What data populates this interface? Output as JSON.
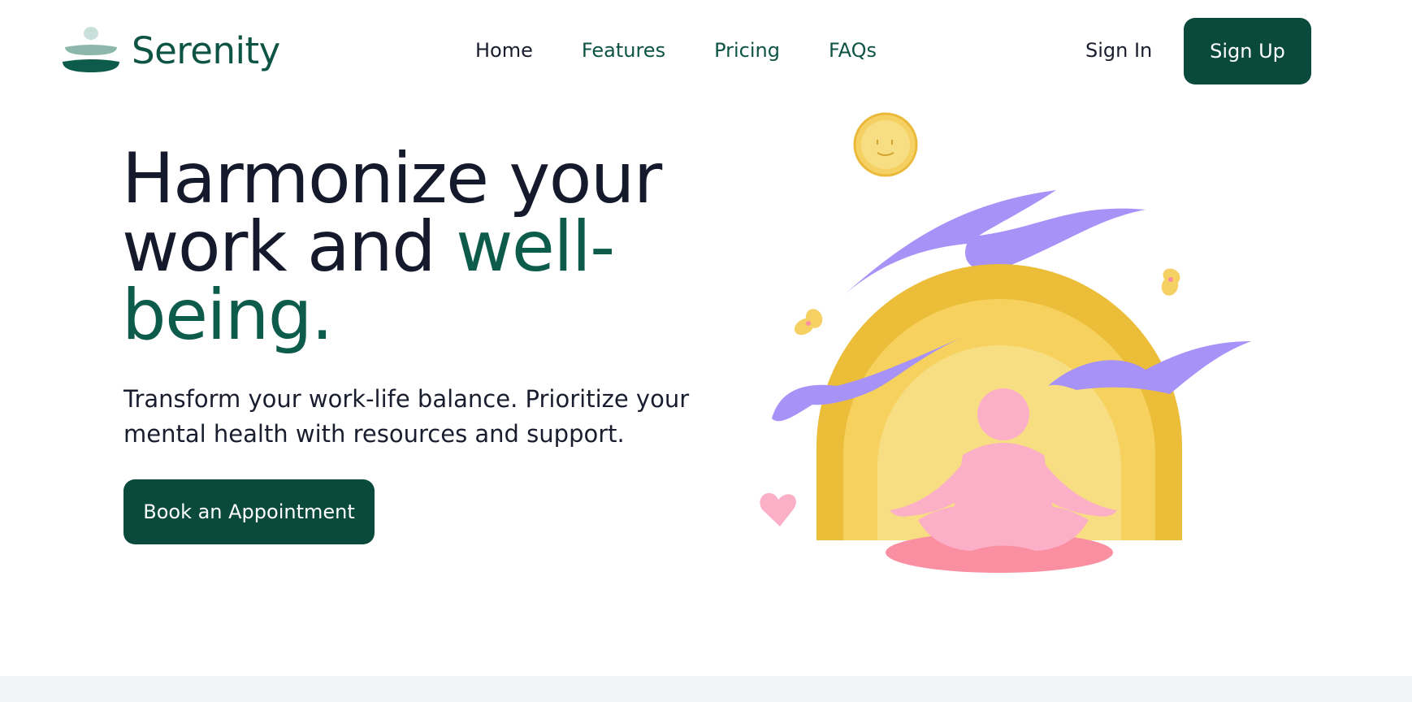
{
  "brand": {
    "name": "Serenity"
  },
  "nav": {
    "items": [
      "Home",
      "Features",
      "Pricing",
      "FAQs"
    ],
    "sign_in": "Sign In",
    "sign_up": "Sign Up"
  },
  "hero": {
    "title_part1": "Harmonize your work and",
    "title_accent": "well-being.",
    "subtitle": "Transform your work-life balance. Prioritize your mental health with resources and support.",
    "cta_label": "Book an Appointment"
  },
  "colors": {
    "primary": "#0a4a3c",
    "accent_text": "#0d5b4a",
    "sun_yellow": "#f5d063",
    "arch_outer": "#ebbd38",
    "arch_mid": "#f6d15e",
    "arch_inner": "#f8de83",
    "cloud_purple": "#a792f8",
    "figure_pink": "#fbb0c7",
    "mat_pink": "#fb8fa2"
  },
  "icons": [
    "logo-icon",
    "sun-icon",
    "butterfly-icon",
    "heart-icon"
  ]
}
